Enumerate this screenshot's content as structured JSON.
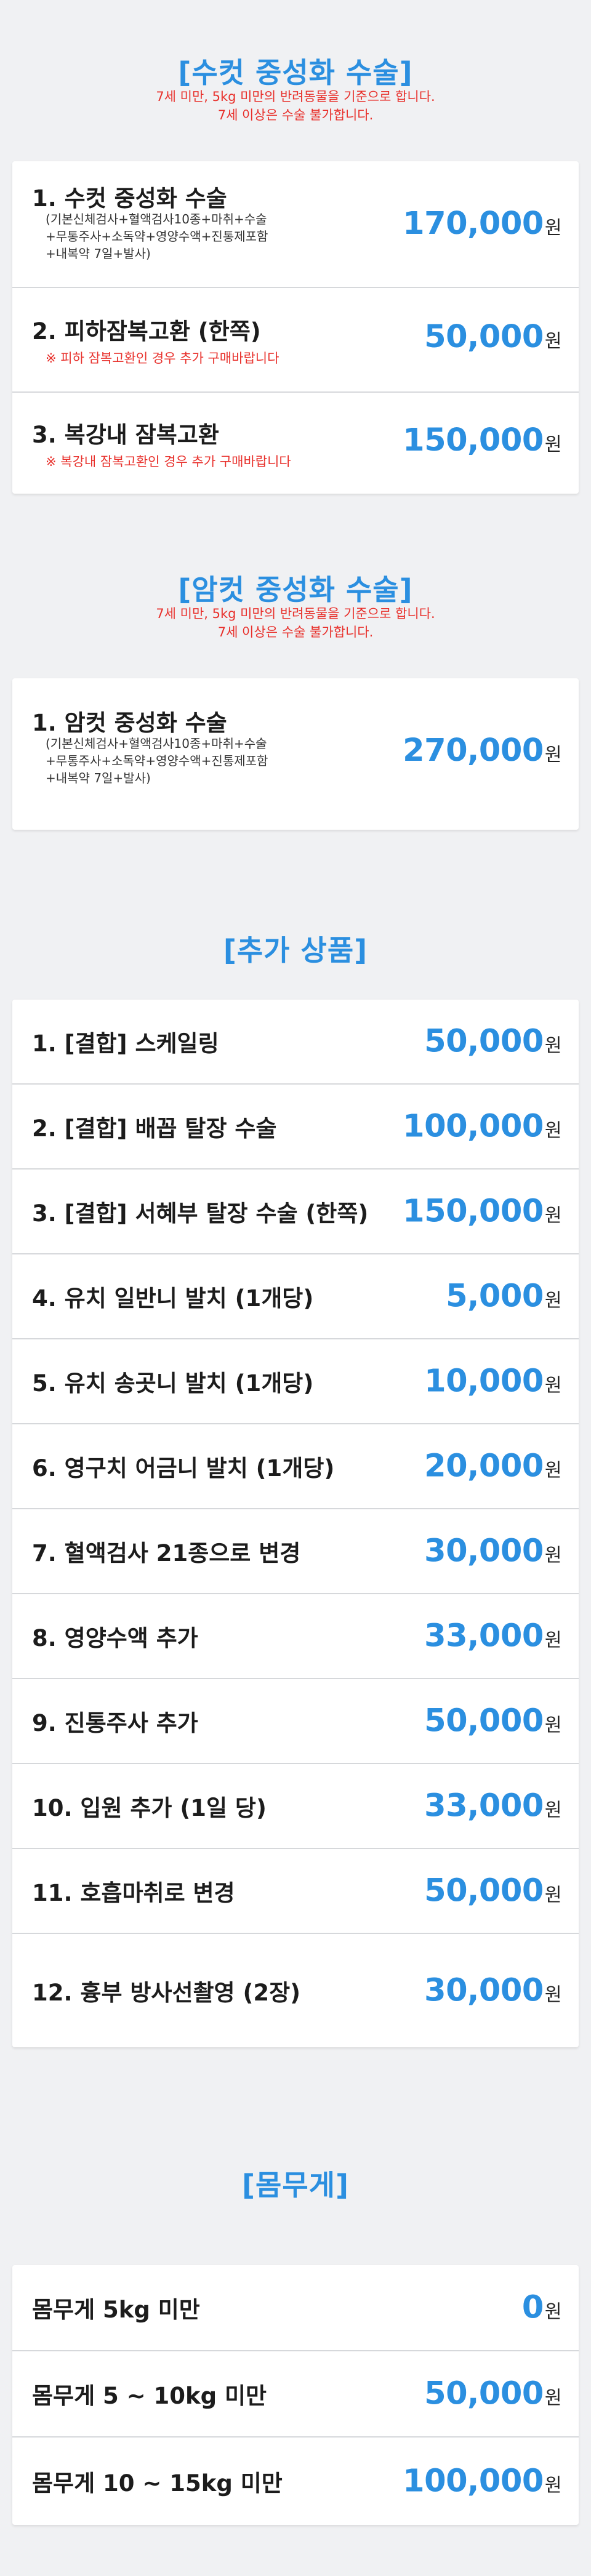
{
  "neuter_section": {
    "title": "[수컷 중성화 수술]",
    "note_line1": "7세 미만, 5kg 미만의 반려동물을 기준으로 합니다.",
    "note_line2": "7세 이상은 수술 불가합니다.",
    "items": [
      {
        "name": "1. 수컷 중성화 수술",
        "details": [
          "(기본신체검사+혈액검사10종+마취+수술",
          "+무통주사+소독약+영양수액+진통제포함",
          "+내복약 7일+발사)"
        ],
        "price": "170,000",
        "unit": "원"
      },
      {
        "name": "2. 피하잠복고환 (한쪽)",
        "warning": "※ 피하 잠복고환인 경우 추가 구매바랍니다",
        "price": "50,000",
        "unit": "원"
      },
      {
        "name": "3. 복강내 잠복고환",
        "warning": "※ 복강내 잠복고환인 경우 추가 구매바랍니다",
        "price": "150,000",
        "unit": "원"
      }
    ]
  },
  "female_section": {
    "title": "[암컷 중성화 수술]",
    "note_line1": "7세 미만, 5kg 미만의 반려동물을 기준으로 합니다.",
    "note_line2": "7세 이상은 수술 불가합니다.",
    "items": [
      {
        "name": "1. 암컷 중성화 수술",
        "details": [
          "(기본신체검사+혈액검사10종+마취+수술",
          "+무통주사+소독약+영양수액+진통제포함",
          "+내복약 7일+발사)"
        ],
        "price": "270,000",
        "unit": "원"
      }
    ]
  },
  "extra_section": {
    "title": "[추가 상품]",
    "items": [
      {
        "name": "1. [결합] 스케일링",
        "price": "50,000",
        "unit": "원"
      },
      {
        "name": "2. [결합] 배꼽 탈장 수술",
        "price": "100,000",
        "unit": "원"
      },
      {
        "name": "3. [결합] 서혜부 탈장 수술 (한쪽)",
        "price": "150,000",
        "unit": "원"
      },
      {
        "name": "4. 유치 일반니 발치 (1개당)",
        "price": "5,000",
        "unit": "원"
      },
      {
        "name": "5. 유치 송곳니 발치 (1개당)",
        "price": "10,000",
        "unit": "원"
      },
      {
        "name": "6. 영구치 어금니 발치 (1개당)",
        "price": "20,000",
        "unit": "원"
      },
      {
        "name": "7. 혈액검사 21종으로 변경",
        "price": "30,000",
        "unit": "원"
      },
      {
        "name": "8. 영양수액 추가",
        "price": "33,000",
        "unit": "원"
      },
      {
        "name": "9. 진통주사 추가",
        "price": "50,000",
        "unit": "원"
      },
      {
        "name": "10. 입원 추가 (1일 당)",
        "price": "33,000",
        "unit": "원"
      },
      {
        "name": "11. 호흡마취로 변경",
        "price": "50,000",
        "unit": "원"
      },
      {
        "name": "12. 흉부 방사선촬영 (2장)",
        "price": "30,000",
        "unit": "원"
      }
    ]
  },
  "weight_section": {
    "title": "[몸무게]",
    "items": [
      {
        "name": "몸무게 5kg 미만",
        "price": "0",
        "unit": "원"
      },
      {
        "name": "몸무게 5 ~ 10kg 미만",
        "price": "50,000",
        "unit": "원"
      },
      {
        "name": "몸무게 10 ~ 15kg 미만",
        "price": "100,000",
        "unit": "원"
      }
    ]
  }
}
